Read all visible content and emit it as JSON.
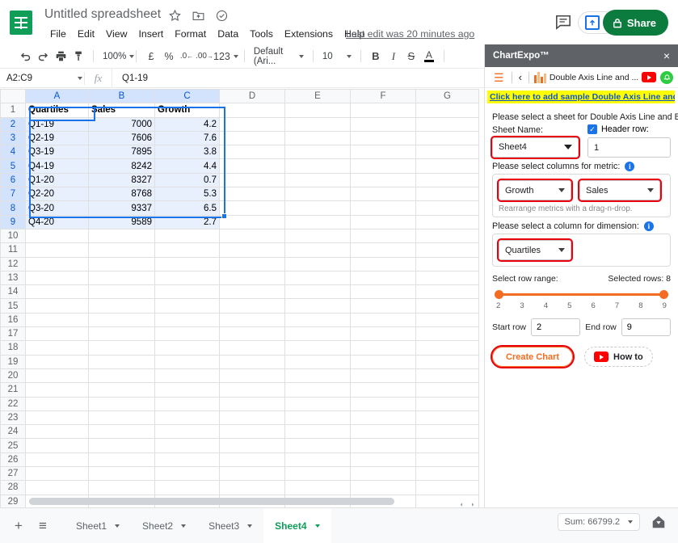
{
  "app": {
    "doc_title": "Untitled spreadsheet",
    "last_edit": "Last edit was 20 minutes ago",
    "menu": [
      "File",
      "Edit",
      "View",
      "Insert",
      "Format",
      "Data",
      "Tools",
      "Extensions",
      "Help"
    ],
    "share_label": "Share"
  },
  "toolbar": {
    "zoom": "100%",
    "number_format": "123",
    "font": "Default (Ari...",
    "font_size": "10",
    "currency": "£",
    "percent": "%",
    "dec_less": ".0",
    "dec_more": ".00",
    "bold": "B",
    "italic": "I",
    "strike": "S",
    "text_color": "A"
  },
  "formula_bar": {
    "name_box": "A2:C9",
    "fx": "fx",
    "value": "Q1-19"
  },
  "grid": {
    "columns": [
      "A",
      "B",
      "C",
      "D",
      "E",
      "F",
      "G"
    ],
    "selected_columns": [
      "A",
      "B",
      "C"
    ],
    "selected_rows": [
      2,
      3,
      4,
      5,
      6,
      7,
      8,
      9
    ],
    "total_rows": 29,
    "header_row": [
      "Quartiles",
      "Sales",
      "Growth"
    ],
    "rows": [
      [
        "Q1-19",
        "7000",
        "4.2"
      ],
      [
        "Q2-19",
        "7606",
        "7.6"
      ],
      [
        "Q3-19",
        "7895",
        "3.8"
      ],
      [
        "Q4-19",
        "8242",
        "4.4"
      ],
      [
        "Q1-20",
        "8327",
        "0.7"
      ],
      [
        "Q2-20",
        "8768",
        "5.3"
      ],
      [
        "Q3-20",
        "9337",
        "6.5"
      ],
      [
        "Q4-20",
        "9589",
        "2.7"
      ]
    ]
  },
  "panel": {
    "title": "ChartExpo™",
    "close": "×",
    "nav_chart_name": "Double Axis Line and ...",
    "sample_link": "Click here to add sample Double Axis Line and Ba...",
    "sheet_prompt": "Please select a sheet for Double Axis Line and Bar C...",
    "sheet_name_label": "Sheet Name:",
    "sheet_name_value": "Sheet4",
    "header_row_label": "Header row:",
    "header_row_value": "1",
    "metric_prompt": "Please select columns for metric:",
    "metric_1": "Growth",
    "metric_2": "Sales",
    "metric_hint": "Rearrange metrics with a drag-n-drop.",
    "dimension_prompt": "Please select a column for dimension:",
    "dimension_value": "Quartiles",
    "row_range_label": "Select row range:",
    "selected_rows_label": "Selected rows: 8",
    "slider_ticks": [
      "2",
      "3",
      "4",
      "5",
      "6",
      "7",
      "8",
      "9"
    ],
    "start_row_label": "Start row",
    "start_row_value": "2",
    "end_row_label": "End row",
    "end_row_value": "9",
    "create_chart": "Create Chart",
    "how_to": "How to"
  },
  "bottom": {
    "add_sheet": "+",
    "all_sheets": "≡",
    "tabs": [
      {
        "label": "Sheet1",
        "active": false
      },
      {
        "label": "Sheet2",
        "active": false
      },
      {
        "label": "Sheet3",
        "active": false
      },
      {
        "label": "Sheet4",
        "active": true
      }
    ],
    "sum": "Sum: 66799.2"
  },
  "colors": {
    "sheets_green": "#0f9d58",
    "share_green": "#0b7b3e",
    "accent_blue": "#1a73e8",
    "chartexpo_orange": "#f36c21",
    "highlight_yellow": "#ffff00",
    "red_outline": "#e8000d",
    "selection_fill": "#e8f0fe"
  }
}
